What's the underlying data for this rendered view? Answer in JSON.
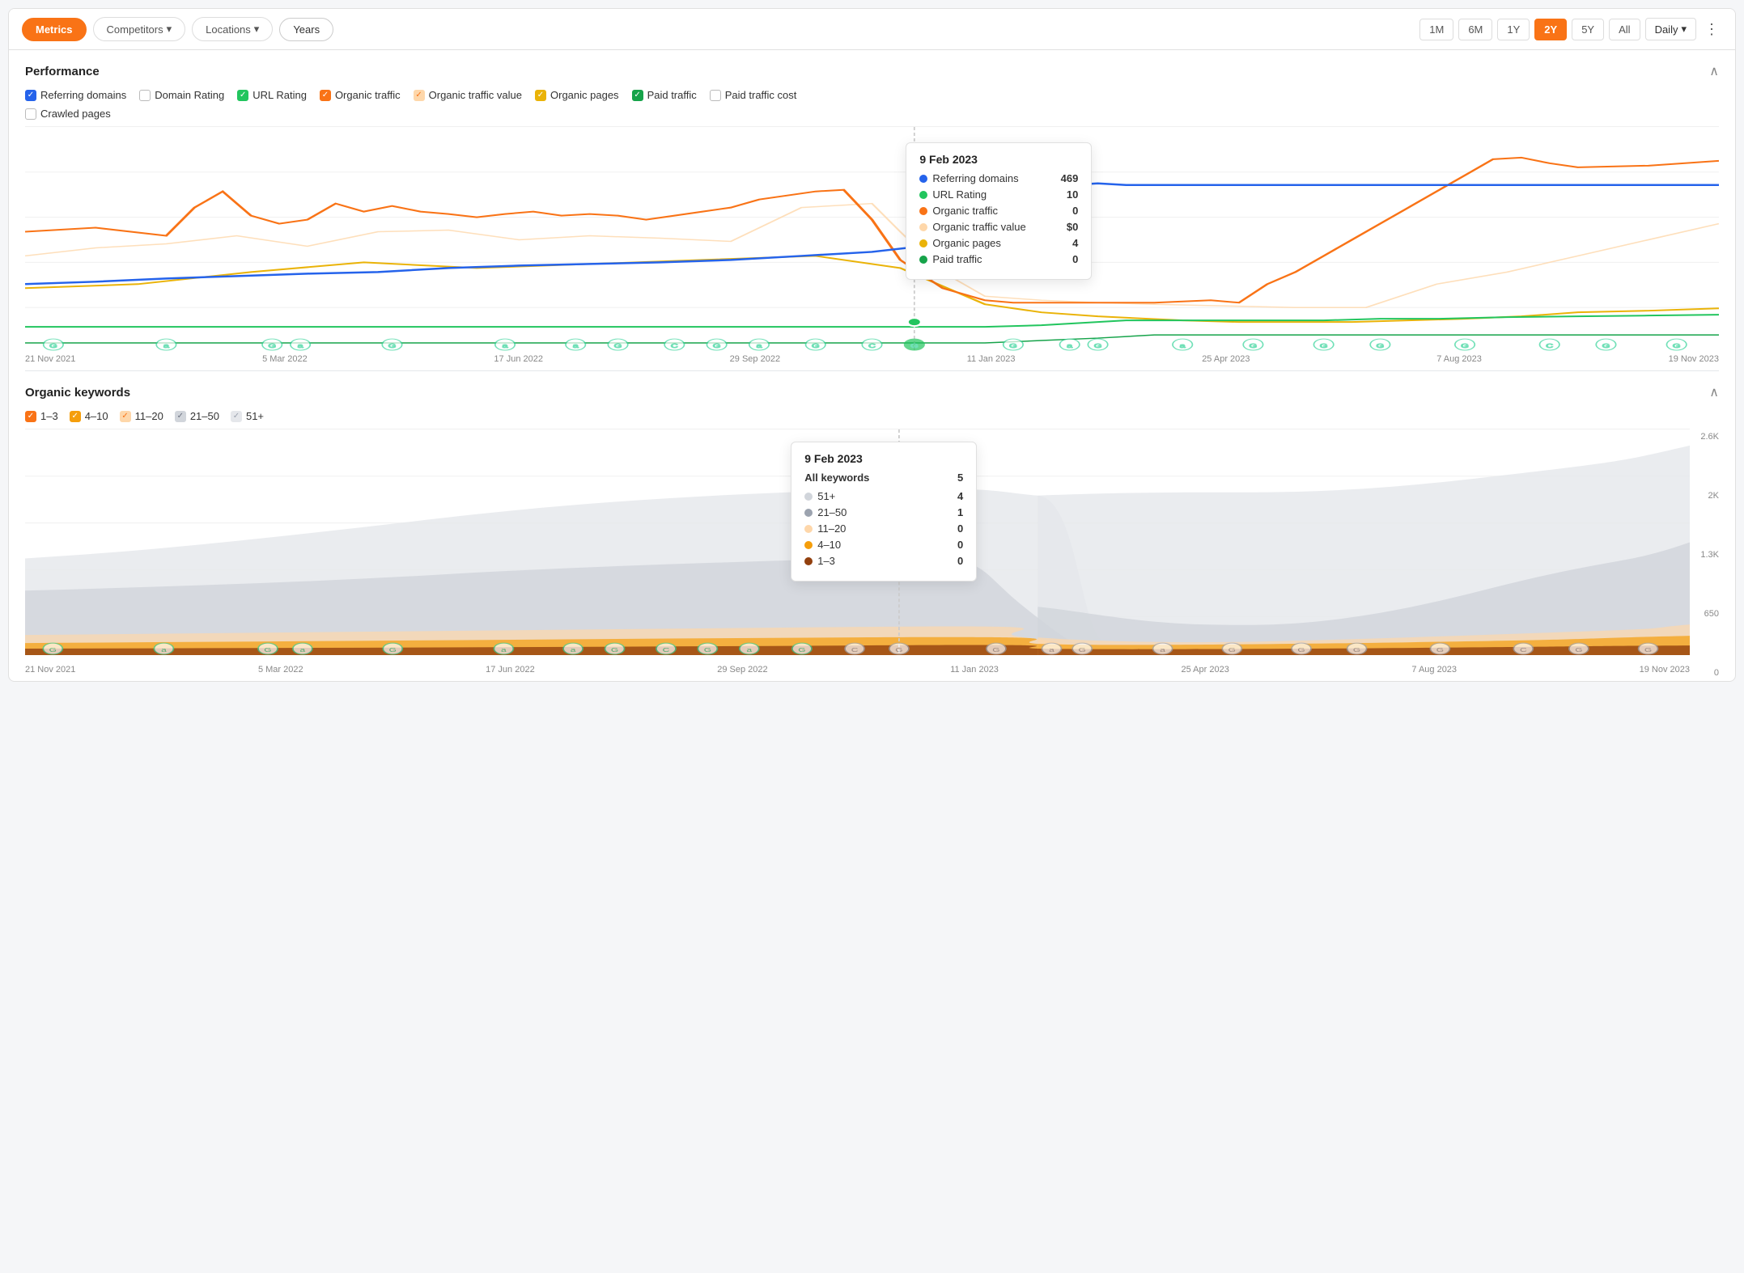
{
  "nav": {
    "left_buttons": [
      {
        "label": "Metrics",
        "active": true,
        "id": "metrics"
      },
      {
        "label": "Competitors",
        "dropdown": true,
        "active": false,
        "id": "competitors"
      },
      {
        "label": "Locations",
        "dropdown": true,
        "active": false,
        "id": "locations"
      },
      {
        "label": "Years",
        "active": false,
        "id": "years"
      }
    ],
    "time_buttons": [
      "1M",
      "6M",
      "1Y",
      "2Y",
      "5Y",
      "All"
    ],
    "active_time": "2Y",
    "daily_label": "Daily",
    "more_icon": "⋮"
  },
  "performance": {
    "title": "Performance",
    "metrics": [
      {
        "label": "Referring domains",
        "checked": true,
        "color": "blue"
      },
      {
        "label": "Domain Rating",
        "checked": false,
        "color": "none"
      },
      {
        "label": "URL Rating",
        "checked": true,
        "color": "green"
      },
      {
        "label": "Organic traffic",
        "checked": true,
        "color": "orange"
      },
      {
        "label": "Organic traffic value",
        "checked": true,
        "color": "lightorange"
      },
      {
        "label": "Organic pages",
        "checked": true,
        "color": "yellow"
      },
      {
        "label": "Paid traffic",
        "checked": true,
        "color": "darkgreen"
      },
      {
        "label": "Paid traffic cost",
        "checked": false,
        "color": "none"
      },
      {
        "label": "Crawled pages",
        "checked": false,
        "color": "none"
      }
    ],
    "tooltip": {
      "date": "9 Feb 2023",
      "rows": [
        {
          "label": "Referring domains",
          "color": "#2563eb",
          "value": "469"
        },
        {
          "label": "URL Rating",
          "color": "#22c55e",
          "value": "10"
        },
        {
          "label": "Organic traffic",
          "color": "#f97316",
          "value": "0"
        },
        {
          "label": "Organic traffic value",
          "color": "#fed7aa",
          "value": "$0"
        },
        {
          "label": "Organic pages",
          "color": "#eab308",
          "value": "4"
        },
        {
          "label": "Paid traffic",
          "color": "#16a34a",
          "value": "0"
        }
      ]
    },
    "x_labels": [
      "21 Nov 2021",
      "5 Mar 2022",
      "17 Jun 2022",
      "29 Sep 2022",
      "11 Jan 2023",
      "25 Apr 2023",
      "7 Aug 2023",
      "19 Nov 2023"
    ]
  },
  "organic_keywords": {
    "title": "Organic keywords",
    "ranges": [
      {
        "label": "1–3",
        "checked": true,
        "color": "orange-dark"
      },
      {
        "label": "4–10",
        "checked": true,
        "color": "amber"
      },
      {
        "label": "11–20",
        "checked": true,
        "color": "light-orange"
      },
      {
        "label": "21–50",
        "checked": true,
        "color": "light-gray"
      },
      {
        "label": "51+",
        "checked": true,
        "color": "lighter-gray"
      }
    ],
    "tooltip": {
      "date": "9 Feb 2023",
      "all_keywords_label": "All keywords",
      "all_keywords_value": "5",
      "rows": [
        {
          "label": "51+",
          "color": "#d1d5db",
          "value": "4"
        },
        {
          "label": "21–50",
          "color": "#9ca3af",
          "value": "1"
        },
        {
          "label": "11–20",
          "color": "#fed7aa",
          "value": "0"
        },
        {
          "label": "4–10",
          "color": "#f59e0b",
          "value": "0"
        },
        {
          "label": "1–3",
          "color": "#92400e",
          "value": "0"
        }
      ]
    },
    "y_labels": [
      "2.6K",
      "2K",
      "1.3K",
      "650",
      "0"
    ],
    "x_labels": [
      "21 Nov 2021",
      "5 Mar 2022",
      "17 Jun 2022",
      "29 Sep 2022",
      "11 Jan 2023",
      "25 Apr 2023",
      "7 Aug 2023",
      "19 Nov 2023"
    ]
  }
}
